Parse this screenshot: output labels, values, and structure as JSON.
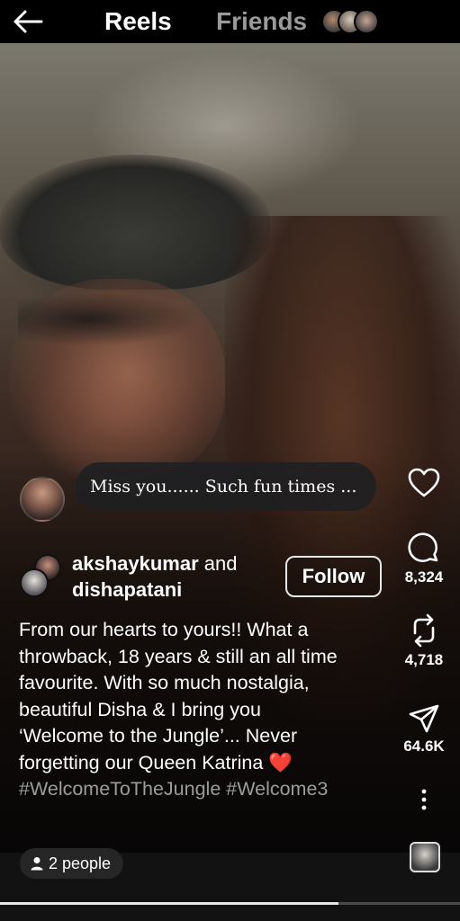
{
  "header": {
    "tabs": [
      {
        "label": "Reels",
        "active": true
      },
      {
        "label": "Friends",
        "active": false
      }
    ],
    "friend_avatar_count": 3
  },
  "comment_bubble": {
    "text": "Miss you...... Such fun times ..."
  },
  "post": {
    "author_primary": "akshaykumar",
    "author_joiner": "and",
    "author_secondary": "dishapatani",
    "follow_label": "Follow",
    "caption_lines": [
      "From our hearts to yours!! What a",
      "throwback, 18 years & still an all time",
      "favourite. With so much nostalgia,",
      "beautiful Disha & I bring you",
      "‘Welcome to the Jungle’... Never",
      "forgetting our Queen Katrina"
    ],
    "caption_emoji": "❤️",
    "hashtags": "#WelcomeToTheJungle #Welcome3"
  },
  "actions": {
    "like": {
      "icon": "heart-icon",
      "count": ""
    },
    "comment": {
      "icon": "comment-icon",
      "count": "8,324"
    },
    "repost": {
      "icon": "repost-icon",
      "count": "4,718"
    },
    "share": {
      "icon": "share-icon",
      "count": "64.6K"
    },
    "more": {
      "icon": "more-icon"
    }
  },
  "footer": {
    "people_label": "2 people",
    "progress_fraction": 0.735
  },
  "colors": {
    "background": "#000000",
    "inactive_tab": "#9a9a9a",
    "hashtag": "#9c9c9c",
    "heart_emoji": "#e0262e"
  }
}
